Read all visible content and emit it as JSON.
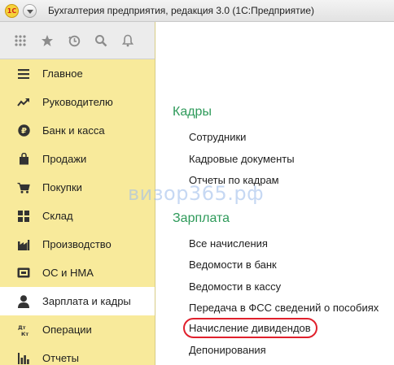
{
  "window": {
    "title": "Бухгалтерия предприятия, редакция 3.0  (1С:Предприятие)",
    "logo_text": "1С"
  },
  "toolbar": {
    "icons": [
      "apps-grid-icon",
      "star-icon",
      "history-icon",
      "search-icon",
      "bell-icon"
    ]
  },
  "sidebar": {
    "items": [
      {
        "label": "Главное",
        "icon": "menu-lines-icon"
      },
      {
        "label": "Руководителю",
        "icon": "trend-icon"
      },
      {
        "label": "Банк и касса",
        "icon": "ruble-icon"
      },
      {
        "label": "Продажи",
        "icon": "shopping-bag-icon"
      },
      {
        "label": "Покупки",
        "icon": "cart-icon"
      },
      {
        "label": "Склад",
        "icon": "warehouse-grid-icon"
      },
      {
        "label": "Производство",
        "icon": "factory-icon"
      },
      {
        "label": "ОС и НМА",
        "icon": "assets-icon"
      },
      {
        "label": "Зарплата и кадры",
        "icon": "person-icon",
        "active": true
      },
      {
        "label": "Операции",
        "icon": "dt-kt-icon"
      },
      {
        "label": "Отчеты",
        "icon": "bar-chart-icon"
      }
    ],
    "ops_icon_text": "Дт\nКт"
  },
  "main": {
    "sections": [
      {
        "title": "Кадры",
        "links": [
          "Сотрудники",
          "Кадровые документы",
          "Отчеты по кадрам"
        ]
      },
      {
        "title": "Зарплата",
        "links": [
          "Все начисления",
          "Ведомости в банк",
          "Ведомости в кассу",
          "Передача в ФСС сведений о пособиях",
          "Начисление дивидендов",
          "Депонирования"
        ]
      }
    ],
    "highlighted_link": "Начисление дивидендов"
  },
  "watermark": "визор365.рф",
  "colors": {
    "sidebar_bg": "#f8ea9b",
    "section_title": "#2e9a5a",
    "highlight_ring": "#e0202c",
    "watermark": "#a0bee8"
  }
}
